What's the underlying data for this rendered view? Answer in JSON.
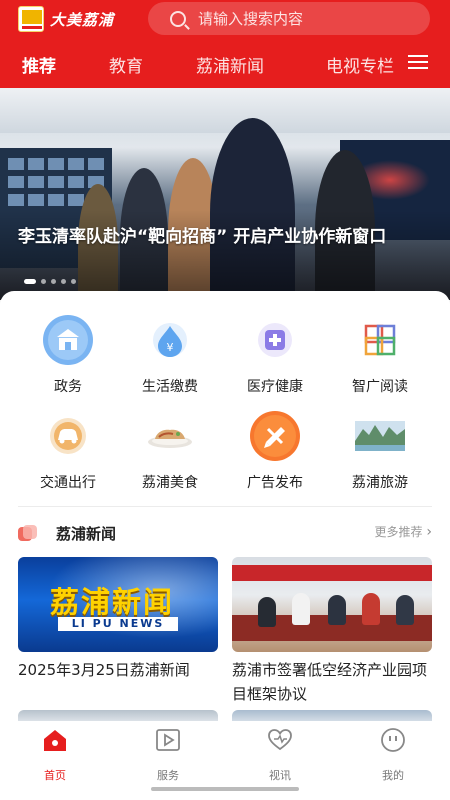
{
  "header": {
    "logo_text": "大美荔浦",
    "search_placeholder": "请输入搜索内容",
    "tabs": [
      "推荐",
      "教育",
      "荔浦新闻",
      "电视专栏"
    ]
  },
  "banner": {
    "title": "李玉清率队赴沪“靶向招商” 开启产业协作新窗口",
    "slide_count": 6,
    "active_slide": 1
  },
  "services": [
    {
      "label": "政务",
      "icon": "government-icon"
    },
    {
      "label": "生活缴费",
      "icon": "payment-icon"
    },
    {
      "label": "医疗健康",
      "icon": "medical-icon"
    },
    {
      "label": "智广阅读",
      "icon": "reading-icon"
    },
    {
      "label": "交通出行",
      "icon": "car-icon"
    },
    {
      "label": "荔浦美食",
      "icon": "food-icon"
    },
    {
      "label": "广告发布",
      "icon": "advertising-icon"
    },
    {
      "label": "荔浦旅游",
      "icon": "tourism-icon"
    }
  ],
  "news_section": {
    "title": "荔浦新闻",
    "more": "更多推荐",
    "items": [
      {
        "title": "2025年3月25日荔浦新闻",
        "image_caption": "荔浦新闻",
        "image_subcaption": "LI PU NEWS"
      },
      {
        "title": "荔浦市签署低空经济产业园项目框架协议",
        "image_caption": ""
      }
    ]
  },
  "tabbar": {
    "items": [
      "首页",
      "服务",
      "视讯",
      "我的"
    ],
    "active": 0
  },
  "colors": {
    "brand_red": "#e61e1e",
    "text": "#222222",
    "muted": "#999999"
  }
}
